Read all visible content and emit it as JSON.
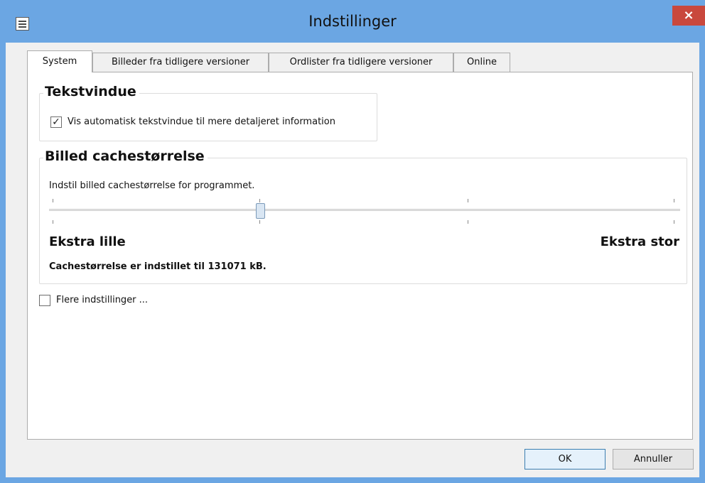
{
  "window": {
    "title": "Indstillinger",
    "close_label": "×"
  },
  "tabs": [
    {
      "label": "System",
      "active": true
    },
    {
      "label": "Billeder fra tidligere versioner",
      "active": false
    },
    {
      "label": "Ordlister fra tidligere versioner",
      "active": false
    },
    {
      "label": "Online",
      "active": false
    }
  ],
  "tekstvindue": {
    "title": "Tekstvindue",
    "checkbox_label": "Vis automatisk tekstvindue til mere detaljeret information",
    "checked": true
  },
  "cache": {
    "title": "Billed cachestørrelse",
    "description": "Indstil billed cachestørrelse for programmet.",
    "slider_level": 0.333,
    "min_label": "Ekstra lille",
    "max_label": "Ekstra stor",
    "status": "Cachestørrelse er indstillet til 131071 kB."
  },
  "more_settings": {
    "label": "Flere indstillinger ...",
    "checked": false
  },
  "buttons": {
    "ok": "OK",
    "cancel": "Annuller"
  }
}
